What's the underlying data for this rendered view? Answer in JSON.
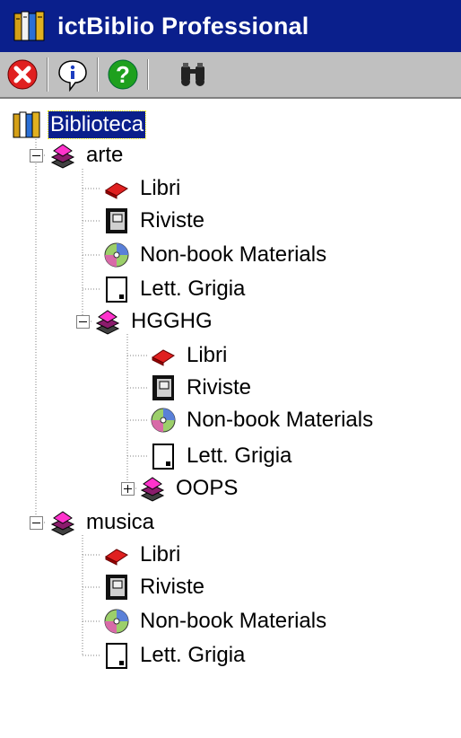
{
  "window": {
    "title": "ictBiblio Professional"
  },
  "toolbar": {
    "buttons": [
      "close",
      "info",
      "help",
      "search"
    ]
  },
  "tree": {
    "root": {
      "label": "Biblioteca"
    },
    "arte": {
      "label": "arte",
      "children": [
        "Libri",
        "Riviste",
        "Non-book Materials",
        "Lett. Grigia"
      ],
      "sub": {
        "label": "HGGHG",
        "children": [
          "Libri",
          "Riviste",
          "Non-book Materials",
          "Lett. Grigia"
        ],
        "oops": {
          "label": "OOPS"
        }
      }
    },
    "musica": {
      "label": "musica",
      "children": [
        "Libri",
        "Riviste",
        "Non-book Materials",
        "Lett. Grigia"
      ]
    }
  }
}
